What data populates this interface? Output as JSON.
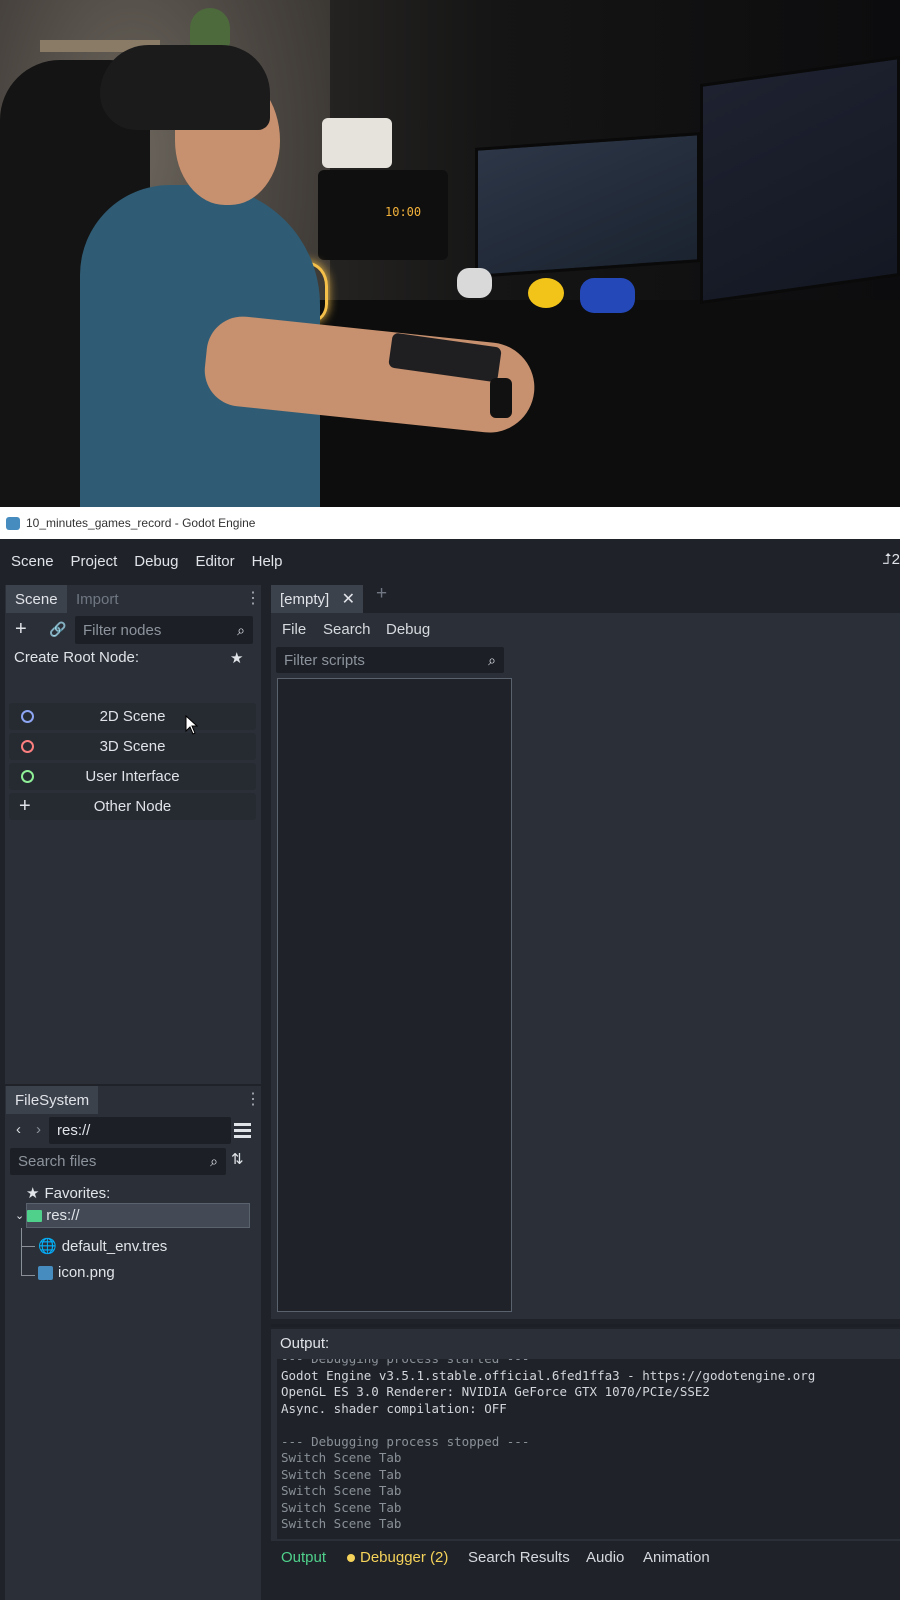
{
  "window": {
    "title": "10_minutes_games_record - Godot Engine"
  },
  "menu": {
    "items": [
      "Scene",
      "Project",
      "Debug",
      "Editor",
      "Help"
    ],
    "right_partial": "2"
  },
  "scene_dock": {
    "tabs": [
      "Scene",
      "Import"
    ],
    "filter_placeholder": "Filter nodes",
    "create_root_label": "Create Root Node:",
    "buttons": [
      "2D Scene",
      "3D Scene",
      "User Interface",
      "Other Node"
    ]
  },
  "filesystem_dock": {
    "tab": "FileSystem",
    "path": "res://",
    "search_placeholder": "Search files",
    "favorites_label": "Favorites:",
    "root_folder": "res://",
    "files": [
      "default_env.tres",
      "icon.png"
    ]
  },
  "script_editor": {
    "tab": "[empty]",
    "menus": [
      "File",
      "Search",
      "Debug"
    ],
    "filter_placeholder": "Filter scripts"
  },
  "output": {
    "title": "Output:",
    "lines": [
      "--- Debugging process started ---",
      "Godot Engine v3.5.1.stable.official.6fed1ffa3 - https://godotengine.org",
      "OpenGL ES 3.0 Renderer: NVIDIA GeForce GTX 1070/PCIe/SSE2",
      "Async. shader compilation: OFF",
      "",
      "--- Debugging process stopped ---",
      "Switch Scene Tab",
      "Switch Scene Tab",
      "Switch Scene Tab",
      "Switch Scene Tab",
      "Switch Scene Tab"
    ]
  },
  "bottom_tabs": [
    "Output",
    "Debugger (2)",
    "Search Results",
    "Audio",
    "Animation"
  ],
  "photo_overlay": {
    "clock_text": "10:00"
  },
  "colors": {
    "accent": "#4fd18b",
    "warning": "#f5d25a",
    "icon_2d": "#8da5f3",
    "icon_3d": "#fc7f7f",
    "icon_ui": "#8eef97",
    "folder": "#4fd18b"
  }
}
